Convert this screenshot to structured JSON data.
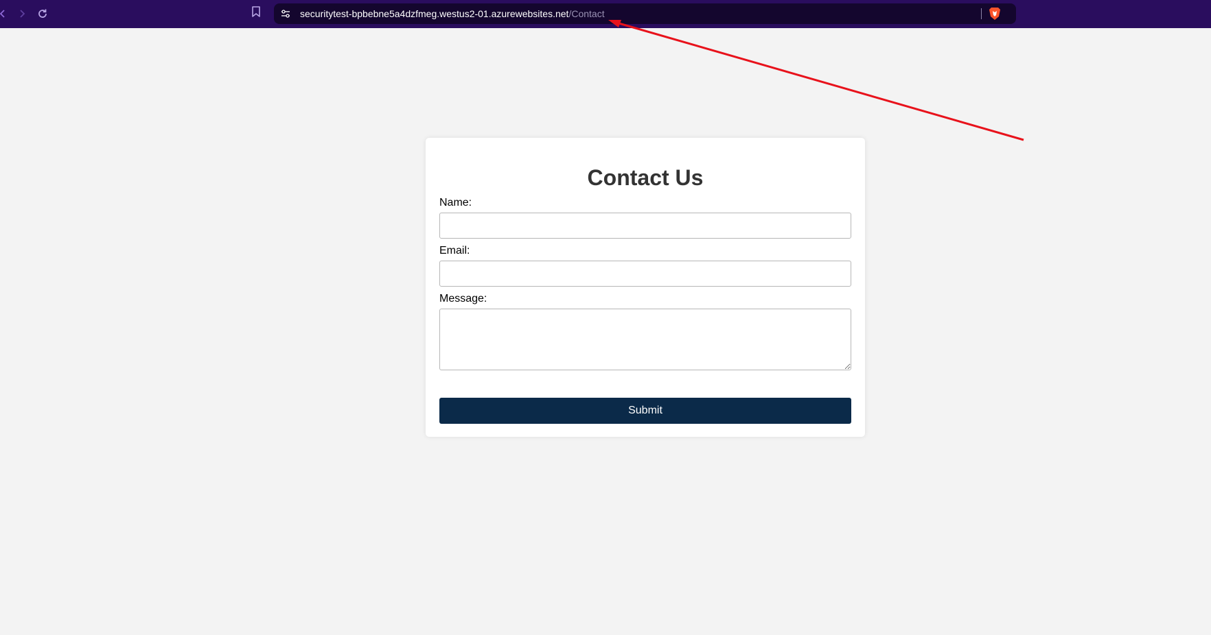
{
  "browser": {
    "url_host": "securitytest-bpbebne5a4dzfmeg.westus2-01.azurewebsites.net",
    "url_path": "/Contact",
    "icons": [
      "back-icon",
      "forward-icon",
      "reload-icon",
      "bookmark-icon",
      "site-settings-icon",
      "brave-shield-icon"
    ]
  },
  "contact": {
    "title": "Contact Us",
    "name_label": "Name:",
    "name_value": "",
    "email_label": "Email:",
    "email_value": "",
    "message_label": "Message:",
    "message_value": "",
    "submit_label": "Submit"
  },
  "colors": {
    "browser_bar": "#2a0d5e",
    "url_bar": "#14062e",
    "page_bg": "#f3f3f3",
    "submit_bg": "#0b2a49",
    "annotation_arrow": "#e8121b"
  }
}
